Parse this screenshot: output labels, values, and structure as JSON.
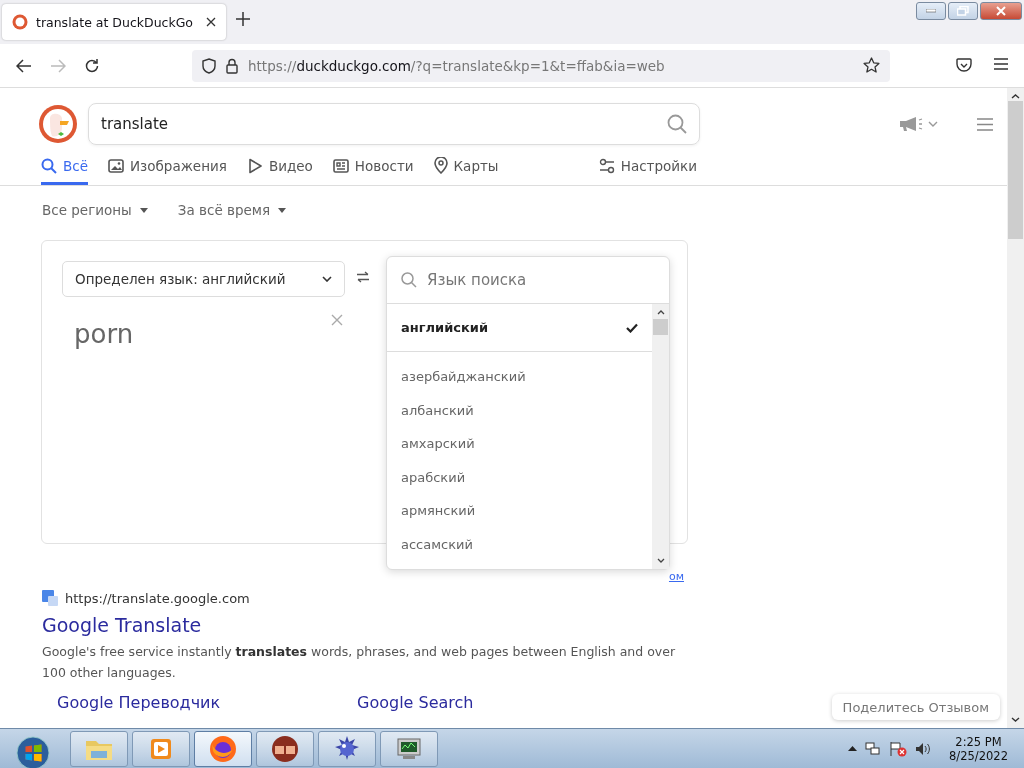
{
  "browser": {
    "tabs": [
      {
        "title": "translate at DuckDuckGo",
        "selected": true
      }
    ],
    "url": {
      "scheme": "https://",
      "host": "duckduckgo.com",
      "rest": "/?q=translate&kp=1&t=ffab&ia=web"
    }
  },
  "search": {
    "value": "translate"
  },
  "nav_tabs": [
    {
      "label": "Всё",
      "kind": "search",
      "selected": true
    },
    {
      "label": "Изображения",
      "kind": "images",
      "selected": false
    },
    {
      "label": "Видео",
      "kind": "video",
      "selected": false
    },
    {
      "label": "Новости",
      "kind": "news",
      "selected": false
    },
    {
      "label": "Карты",
      "kind": "maps",
      "selected": false
    }
  ],
  "settings": {
    "label": "Настройки"
  },
  "filters": [
    "Все регионы",
    "За всё время"
  ],
  "translator": {
    "source_language": "Определен язык: английский",
    "input": "porn",
    "language_search": {
      "placeholder": "Язык поиска"
    },
    "languages": [
      {
        "name": "английский",
        "selected": true
      },
      {
        "name": "азербайджанский",
        "selected": false
      },
      {
        "name": "албанский",
        "selected": false
      },
      {
        "name": "амхарский",
        "selected": false
      },
      {
        "name": "арабский",
        "selected": false
      },
      {
        "name": "армянский",
        "selected": false
      },
      {
        "name": "ассамский",
        "selected": false
      }
    ],
    "link_fragment": "ом"
  },
  "result": {
    "url": "https://translate.google.com",
    "title": "Google Translate",
    "snippet": "Google's free service instantly **translates** words, phrases, and web pages between English and over 100 other languages.",
    "sitelinks": [
      "Google Переводчик",
      "Google Search"
    ]
  },
  "feedback": "Поделитесь Отзывом",
  "taskbar": {
    "apps": [
      {
        "kind": "folder",
        "selected": false
      },
      {
        "kind": "media",
        "selected": false
      },
      {
        "kind": "firefox",
        "selected": true
      },
      {
        "kind": "hands",
        "selected": false
      },
      {
        "kind": "mine",
        "selected": false
      },
      {
        "kind": "monitor",
        "selected": false
      }
    ],
    "time": "2:25 PM",
    "date": "8/25/2022"
  }
}
